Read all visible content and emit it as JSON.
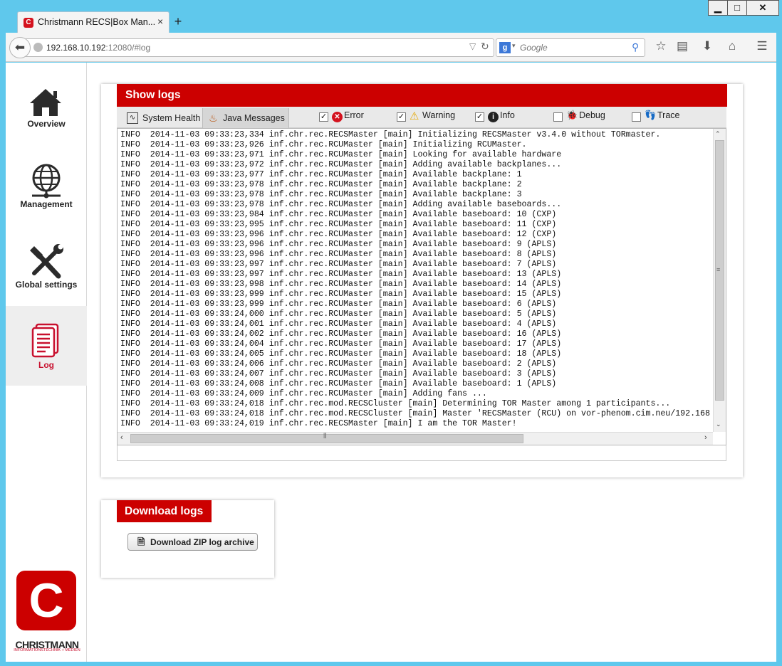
{
  "browser": {
    "tab_title": "Christmann RECS|Box Man...",
    "tab_favicon": "C",
    "new_tab": "+",
    "url_host": "192.168.10.192",
    "url_rest": ":12080/#log",
    "search_placeholder": "Google",
    "search_engine_icon": "g"
  },
  "sidebar": {
    "items": [
      {
        "label": "Overview",
        "icon": "house-icon"
      },
      {
        "label": "Management",
        "icon": "globe-network-icon"
      },
      {
        "label": "Global settings",
        "icon": "tools-icon"
      },
      {
        "label": "Log",
        "icon": "document-icon"
      }
    ],
    "active": "Log",
    "logo_letter": "C",
    "brand_name": "CHRISTMANN",
    "brand_tagline": "INFORMATIONSTECHNIK + MEDIEN"
  },
  "show_logs": {
    "title": "Show logs",
    "tabs": [
      "System Health",
      "Java Messages"
    ],
    "filters": [
      {
        "label": "Error",
        "checked": true
      },
      {
        "label": "Warning",
        "checked": true
      },
      {
        "label": "Info",
        "checked": true
      },
      {
        "label": "Debug",
        "checked": false
      },
      {
        "label": "Trace",
        "checked": false
      }
    ],
    "log_lines": [
      "INFO  2014-11-03 09:33:23,334 inf.chr.rec.RECSMaster [main] Initializing RECSMaster v3.4.0 without TORmaster.",
      "INFO  2014-11-03 09:33:23,926 inf.chr.rec.RCUMaster [main] Initializing RCUMaster.",
      "INFO  2014-11-03 09:33:23,971 inf.chr.rec.RCUMaster [main] Looking for available hardware",
      "INFO  2014-11-03 09:33:23,972 inf.chr.rec.RCUMaster [main] Adding available backplanes...",
      "INFO  2014-11-03 09:33:23,977 inf.chr.rec.RCUMaster [main] Available backplane: 1",
      "INFO  2014-11-03 09:33:23,978 inf.chr.rec.RCUMaster [main] Available backplane: 2",
      "INFO  2014-11-03 09:33:23,978 inf.chr.rec.RCUMaster [main] Available backplane: 3",
      "INFO  2014-11-03 09:33:23,978 inf.chr.rec.RCUMaster [main] Adding available baseboards...",
      "INFO  2014-11-03 09:33:23,984 inf.chr.rec.RCUMaster [main] Available baseboard: 10 (CXP)",
      "INFO  2014-11-03 09:33:23,995 inf.chr.rec.RCUMaster [main] Available baseboard: 11 (CXP)",
      "INFO  2014-11-03 09:33:23,996 inf.chr.rec.RCUMaster [main] Available baseboard: 12 (CXP)",
      "INFO  2014-11-03 09:33:23,996 inf.chr.rec.RCUMaster [main] Available baseboard: 9 (APLS)",
      "INFO  2014-11-03 09:33:23,996 inf.chr.rec.RCUMaster [main] Available baseboard: 8 (APLS)",
      "INFO  2014-11-03 09:33:23,997 inf.chr.rec.RCUMaster [main] Available baseboard: 7 (APLS)",
      "INFO  2014-11-03 09:33:23,997 inf.chr.rec.RCUMaster [main] Available baseboard: 13 (APLS)",
      "INFO  2014-11-03 09:33:23,998 inf.chr.rec.RCUMaster [main] Available baseboard: 14 (APLS)",
      "INFO  2014-11-03 09:33:23,999 inf.chr.rec.RCUMaster [main] Available baseboard: 15 (APLS)",
      "INFO  2014-11-03 09:33:23,999 inf.chr.rec.RCUMaster [main] Available baseboard: 6 (APLS)",
      "INFO  2014-11-03 09:33:24,000 inf.chr.rec.RCUMaster [main] Available baseboard: 5 (APLS)",
      "INFO  2014-11-03 09:33:24,001 inf.chr.rec.RCUMaster [main] Available baseboard: 4 (APLS)",
      "INFO  2014-11-03 09:33:24,002 inf.chr.rec.RCUMaster [main] Available baseboard: 16 (APLS)",
      "INFO  2014-11-03 09:33:24,004 inf.chr.rec.RCUMaster [main] Available baseboard: 17 (APLS)",
      "INFO  2014-11-03 09:33:24,005 inf.chr.rec.RCUMaster [main] Available baseboard: 18 (APLS)",
      "INFO  2014-11-03 09:33:24,006 inf.chr.rec.RCUMaster [main] Available baseboard: 2 (APLS)",
      "INFO  2014-11-03 09:33:24,007 inf.chr.rec.RCUMaster [main] Available baseboard: 3 (APLS)",
      "INFO  2014-11-03 09:33:24,008 inf.chr.rec.RCUMaster [main] Available baseboard: 1 (APLS)",
      "INFO  2014-11-03 09:33:24,009 inf.chr.rec.RCUMaster [main] Adding fans ...",
      "INFO  2014-11-03 09:33:24,018 inf.chr.rec.mod.RECSCluster [main] Determining TOR Master among 1 participants...",
      "INFO  2014-11-03 09:33:24,018 inf.chr.rec.mod.RECSCluster [main] Master 'RECSMaster (RCU) on vor-phenom.cim.neu/192.168",
      "INFO  2014-11-03 09:33:24,019 inf.chr.rec.RECSMaster [main] I am the TOR Master!"
    ]
  },
  "download_logs": {
    "title": "Download logs",
    "button_label": "Download ZIP log archive"
  },
  "colors": {
    "accent_red": "#cc0000",
    "browser_frame": "#5fc8ec"
  }
}
